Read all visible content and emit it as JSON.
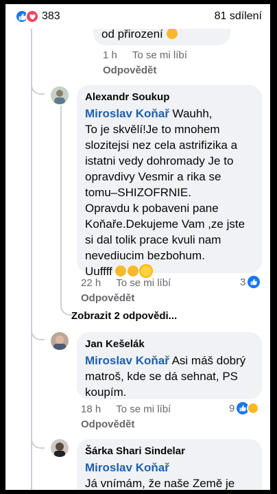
{
  "header": {
    "reaction_count": "383",
    "shares": "81 sdílení",
    "icons": [
      "thumbs-up-icon",
      "heart-icon"
    ]
  },
  "partial_comment": {
    "text_tail": "od přirození",
    "time": "1 h",
    "like_label": "To se mi líbí",
    "reply_label": "Odpovědět"
  },
  "comments": [
    {
      "author": "Alexandr Soukup",
      "mention": "Miroslav Koňař",
      "text": " Wauhh,\nTo je skvělí!Je to mnohem slozitejsi nez cela astrifizika a istatni vedy dohromady Je to opravdivy Vesmir a rika se tomu–SHIZOFRNIE.\nOpravdu k pobaveni pane Koňaře.Dekujeme Vam ,ze jste si dal tolik prace kvuli nam nevediucim bezbohum.\nUuffff",
      "time": "22 h",
      "like_label": "To se mi líbí",
      "reply_label": "Odpovědět",
      "reactions": "3",
      "view_replies": "Zobrazit 2 odpovědi..."
    },
    {
      "author": "Jan Kešelák",
      "mention": "Miroslav Koňař",
      "text": " Asi máš dobrý matroš, kde se dá sehnat, PS koupím.",
      "time": "18 h",
      "like_label": "To se mi líbí",
      "reply_label": "Odpovědět",
      "reactions": "9"
    },
    {
      "author": "Šárka Shari Sindelar",
      "mention": "Miroslav Koňař",
      "text": "Já vnímám, že naše Země je",
      "time": "",
      "like_label": "",
      "reply_label": ""
    }
  ],
  "colors": {
    "like_blue": "#1877f2",
    "love_red": "#f3425f",
    "mention": "#1d5fb0",
    "bubble": "#f0f2f5",
    "meta": "#65676b"
  }
}
